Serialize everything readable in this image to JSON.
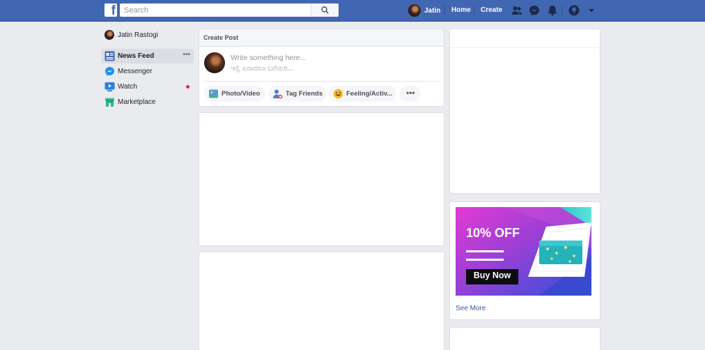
{
  "topbar": {
    "logo": "f",
    "search_placeholder": "Search",
    "user_name": "Jatin",
    "home_label": "Home",
    "create_label": "Create",
    "icons": [
      "friends-icon",
      "messenger-icon",
      "notifications-icon",
      "help-icon",
      "account-menu-icon"
    ]
  },
  "sidebar": {
    "profile_name": "Jatin Rastogi",
    "items": [
      {
        "label": "News Feed",
        "icon": "news-feed-icon",
        "active": true
      },
      {
        "label": "Messenger",
        "icon": "messenger-icon"
      },
      {
        "label": "Watch",
        "icon": "watch-icon",
        "badge": true
      },
      {
        "label": "Marketplace",
        "icon": "marketplace-icon"
      }
    ],
    "more": "•••"
  },
  "composer": {
    "title": "Create Post",
    "placeholder_line1": "Write something here...",
    "placeholder_line2": "ಇಲ್ಲಿ ಏನಾದರೂ ಬರೆಯಿರಿ...",
    "actions": [
      {
        "label": "Photo/Video",
        "icon": "photo-video-icon"
      },
      {
        "label": "Tag Friends",
        "icon": "tag-friends-icon"
      },
      {
        "label": "Feeling/Activ...",
        "icon": "feeling-icon"
      },
      {
        "label": "•••",
        "icon": "more-icon"
      }
    ]
  },
  "ad": {
    "headline": "10% OFF",
    "cta": "Buy Now",
    "see_more": "See More"
  },
  "colors": {
    "brand_blue": "#4267b2",
    "page_bg": "#e9ebee",
    "link": "#385898"
  }
}
